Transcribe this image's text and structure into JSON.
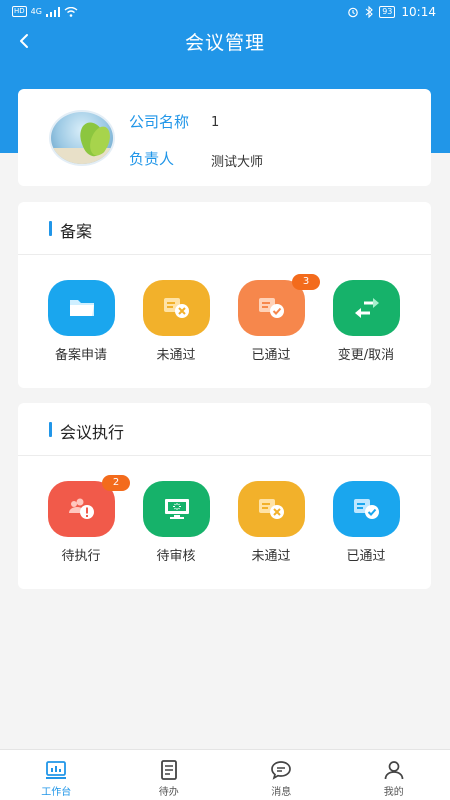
{
  "status_bar": {
    "carrier_badge": "HD",
    "network": "4G",
    "battery": "93",
    "time": "10:14"
  },
  "header": {
    "title": "会议管理",
    "back_icon": "chevron-left-icon",
    "background_color": "#2196e8"
  },
  "company": {
    "name_label": "公司名称",
    "name_value": "1",
    "owner_label": "负责人",
    "owner_value": "测试大师"
  },
  "filing": {
    "title": "备案",
    "items": [
      {
        "label": "备案申请",
        "icon": "folder-icon",
        "color": "#1aa6ee",
        "badge": ""
      },
      {
        "label": "未通过",
        "icon": "rejected-doc-icon",
        "color": "#f2b12b",
        "badge": ""
      },
      {
        "label": "已通过",
        "icon": "approved-doc-icon",
        "color": "#f6874c",
        "badge": "3"
      },
      {
        "label": "变更/取消",
        "icon": "swap-arrows-icon",
        "color": "#16b26a",
        "badge": ""
      }
    ]
  },
  "meeting": {
    "title": "会议执行",
    "items": [
      {
        "label": "待执行",
        "icon": "pending-group-icon",
        "color": "#f15a4a",
        "badge": "2"
      },
      {
        "label": "待审核",
        "icon": "monitor-review-icon",
        "color": "#16b26a",
        "badge": ""
      },
      {
        "label": "未通过",
        "icon": "rejected-doc-icon",
        "color": "#f2b12b",
        "badge": ""
      },
      {
        "label": "已通过",
        "icon": "approved-doc-icon",
        "color": "#1aa6ee",
        "badge": ""
      }
    ]
  },
  "tabs": [
    {
      "label": "工作台",
      "icon": "dashboard-icon",
      "active": true
    },
    {
      "label": "待办",
      "icon": "todo-icon",
      "active": false
    },
    {
      "label": "消息",
      "icon": "message-icon",
      "active": false
    },
    {
      "label": "我的",
      "icon": "user-icon",
      "active": false
    }
  ]
}
